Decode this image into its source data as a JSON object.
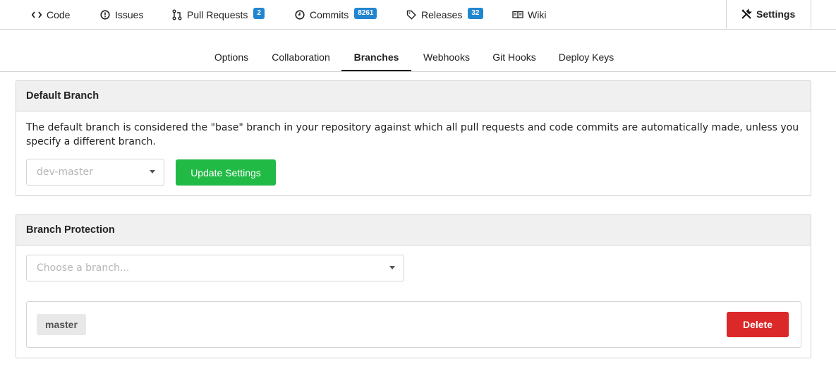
{
  "repo_tabs": [
    {
      "label": "Code",
      "icon": "code-icon",
      "badge": null
    },
    {
      "label": "Issues",
      "icon": "issue-opened-icon",
      "badge": null
    },
    {
      "label": "Pull Requests",
      "icon": "git-pull-request-icon",
      "badge": "2"
    },
    {
      "label": "Commits",
      "icon": "history-icon",
      "badge": "8261"
    },
    {
      "label": "Releases",
      "icon": "tag-icon",
      "badge": "32"
    },
    {
      "label": "Wiki",
      "icon": "book-icon",
      "badge": null
    },
    {
      "label": "Settings",
      "icon": "tools-icon",
      "badge": null,
      "active": true
    }
  ],
  "settings_tabs": [
    {
      "label": "Options"
    },
    {
      "label": "Collaboration"
    },
    {
      "label": "Branches",
      "active": true
    },
    {
      "label": "Webhooks"
    },
    {
      "label": "Git Hooks"
    },
    {
      "label": "Deploy Keys"
    }
  ],
  "default_branch": {
    "title": "Default Branch",
    "description": "The default branch is considered the \"base\" branch in your repository against which all pull requests and code commits are automatically made, unless you specify a different branch.",
    "selected": "dev-master",
    "update_label": "Update Settings"
  },
  "branch_protection": {
    "title": "Branch Protection",
    "placeholder": "Choose a branch...",
    "rules": [
      {
        "branch": "master",
        "delete_label": "Delete"
      }
    ]
  },
  "colors": {
    "badge": "#2185d0",
    "green_button": "#21ba45",
    "red_button": "#db2828"
  }
}
